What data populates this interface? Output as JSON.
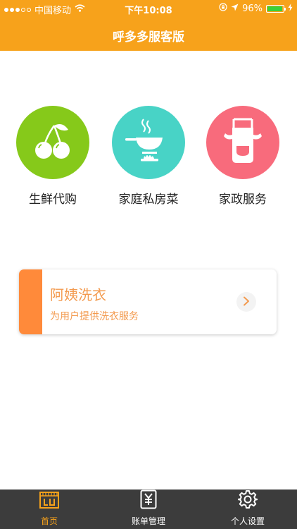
{
  "status_bar": {
    "carrier": "中国移动",
    "time": "下午10:08",
    "battery": "96%",
    "battery_level": 0.96,
    "signal_bars_filled": 3,
    "signal_bars_total": 5,
    "icons": [
      "signal-dots-icon",
      "wifi-icon",
      "orientation-lock-icon",
      "location-arrow-icon",
      "battery-icon",
      "charging-bolt-icon"
    ]
  },
  "header": {
    "title": "呼多多服客版"
  },
  "services": [
    {
      "label": "生鲜代购",
      "icon": "cherry-icon",
      "color": "#86c91a"
    },
    {
      "label": "家庭私房菜",
      "icon": "cooking-pan-icon",
      "color": "#48d3c6"
    },
    {
      "label": "家政服务",
      "icon": "apron-icon",
      "color": "#f86b7c"
    }
  ],
  "card": {
    "title": "阿姨洗衣",
    "subtitle": "为用户提供洗衣服务",
    "accent_color": "#ff8a3a",
    "text_color": "#f39a4e"
  },
  "tab_bar": {
    "tabs": [
      {
        "label": "首页",
        "icon": "home-store-icon",
        "active": true
      },
      {
        "label": "账单管理",
        "icon": "yen-bill-icon",
        "active": false
      },
      {
        "label": "个人设置",
        "icon": "gear-icon",
        "active": false
      }
    ],
    "active_color": "#f7a21b",
    "background": "#3c3c3c"
  },
  "colors": {
    "brand": "#f7a21b"
  }
}
